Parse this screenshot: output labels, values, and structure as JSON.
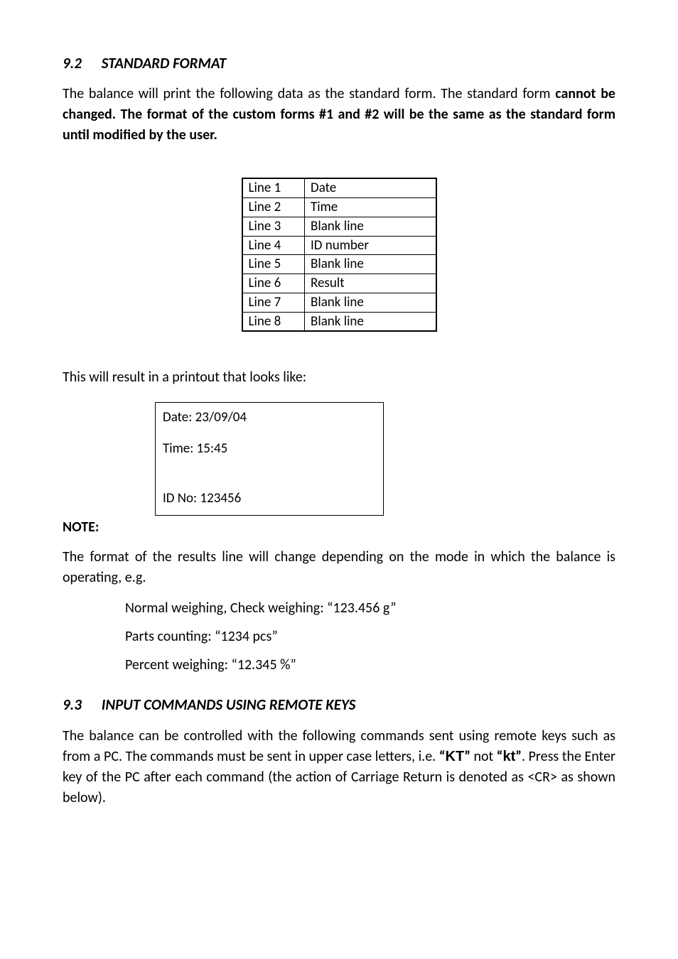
{
  "sec92": {
    "num": "9.2",
    "title": "STANDARD FORMAT",
    "para_plain1": "The balance will print the following data as the standard form. The standard form ",
    "para_bold": "cannot be changed. The format of the custom forms #1 and #2 will be the same as the standard form until modified by the user.",
    "table": [
      {
        "c1": "Line 1",
        "c2": "Date"
      },
      {
        "c1": "Line 2",
        "c2": "Time"
      },
      {
        "c1": "Line 3",
        "c2": "Blank line"
      },
      {
        "c1": "Line 4",
        "c2": "ID number"
      },
      {
        "c1": "Line 5",
        "c2": "Blank line"
      },
      {
        "c1": "Line 6",
        "c2": "Result"
      },
      {
        "c1": "Line 7",
        "c2": "Blank line"
      },
      {
        "c1": "Line 8",
        "c2": "Blank line"
      }
    ],
    "result_intro": "This will result in a printout that looks like:",
    "printout": {
      "l1": "Date:  23/09/04",
      "l2": "Time:  15:45",
      "l3": "ID No: 123456"
    },
    "note_label": "NOTE:",
    "note_para": "The format of the results line will change depending on the mode in which the balance is operating, e.g.",
    "examples": [
      "Normal weighing, Check weighing: “123.456 g”",
      "Parts counting: “1234 pcs”",
      "Percent weighing: “12.345 %”"
    ]
  },
  "sec93": {
    "num": "9.3",
    "title": "INPUT COMMANDS USING REMOTE KEYS",
    "para_seg1": "The balance can be controlled with the following commands sent using remote keys such as from a PC. The commands must be sent in upper case letters, i.e. ",
    "kt_upper_open": "“",
    "kt_upper": "KT",
    "kt_upper_close": "”",
    "para_seg2": " not ",
    "kt_lower_open": "“",
    "kt_lower": "kt",
    "kt_lower_close": "”",
    "para_seg3": ". Press the Enter key of the PC after each command (the action of Carriage Return is denoted as <CR> as shown below)."
  }
}
